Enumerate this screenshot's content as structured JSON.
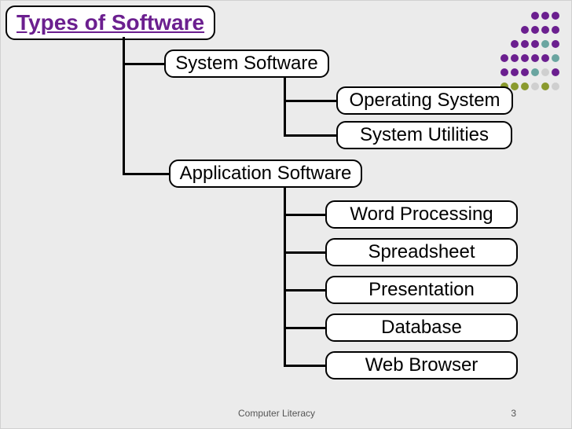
{
  "diagram": {
    "title": "Types of Software",
    "system": {
      "label": "System Software",
      "children": [
        "Operating System",
        "System Utilities"
      ]
    },
    "application": {
      "label": "Application Software",
      "children": [
        "Word Processing",
        "Spreadsheet",
        "Presentation",
        "Database",
        "Web Browser"
      ]
    }
  },
  "footer": {
    "course": "Computer Literacy",
    "page": "3"
  },
  "colors": {
    "title": "#6b1f8f",
    "purple": "#6b1f8f",
    "olive": "#8a9a2e",
    "teal": "#6aa5a0",
    "lightgray": "#cfcfcf"
  }
}
